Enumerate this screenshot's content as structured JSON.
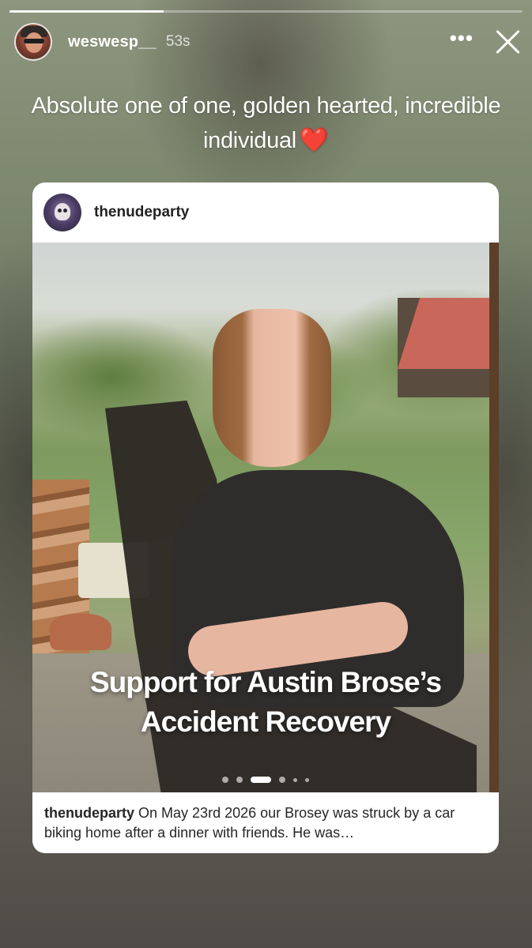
{
  "story": {
    "progress_fraction": 0.3,
    "author": {
      "username": "weswesp__",
      "time_ago": "53s"
    },
    "more_label": "•••",
    "caption_lines": [
      "Absolute one of one, golden hearted, incredible",
      "individual"
    ],
    "caption_emoji": "❤️"
  },
  "shared_post": {
    "username": "thenudeparty",
    "overlay_title_lines": [
      "Support for Austin Brose’s",
      "Accident Recovery"
    ],
    "carousel": {
      "total": 6,
      "active_index": 2
    },
    "caption_owner": "thenudeparty",
    "caption_text": "On May 23rd 2026 our Brosey was struck by a car biking home after a dinner with friends. He was…"
  },
  "colors": {
    "heart": "#e0242b",
    "card_bg": "#ffffff"
  },
  "icons": [
    "more-options-icon",
    "close-icon",
    "heart-emoji-icon"
  ]
}
